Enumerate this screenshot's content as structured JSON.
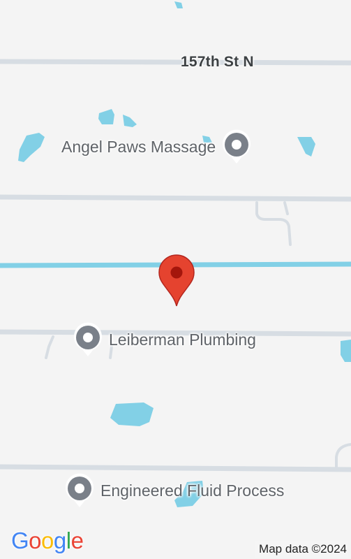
{
  "map": {
    "road_label": "157th St N",
    "pois": [
      {
        "label": "Angel Paws Massage"
      },
      {
        "label": "Leiberman Plumbing"
      },
      {
        "label": "Engineered Fluid Process"
      }
    ],
    "marker": {
      "icon": "red-location-pin-icon"
    },
    "logo": {
      "letters": [
        "G",
        "o",
        "o",
        "g",
        "l",
        "e"
      ],
      "colors": [
        "#4285F4",
        "#EA4335",
        "#FBBC05",
        "#4285F4",
        "#34A853",
        "#EA4335"
      ]
    },
    "attribution": "Map data ©2024",
    "colors": {
      "background": "#f4f4f4",
      "road": "#d7dde3",
      "water": "#82d0e6",
      "marker": "#e5432f",
      "poi_pin": "#7a8089"
    }
  }
}
